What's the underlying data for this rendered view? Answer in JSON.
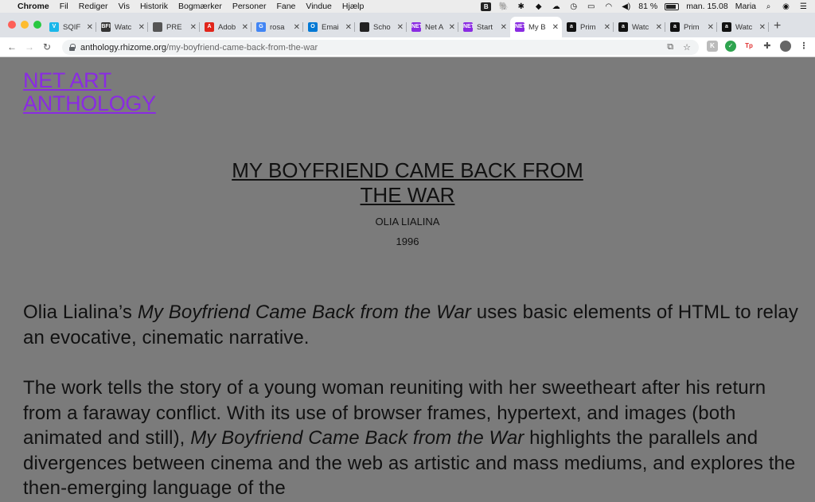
{
  "menubar": {
    "apple_icon": "apple-icon",
    "app_name": "Chrome",
    "menus": [
      "Fil",
      "Rediger",
      "Vis",
      "Historik",
      "Bogmærker",
      "Personer",
      "Fane",
      "Vindue",
      "Hjælp"
    ],
    "battery": "81 %",
    "datetime": "man. 15.08",
    "user": "Maria"
  },
  "tabs": [
    {
      "label": "SQIF",
      "favicon_color": "#1ab7ea",
      "favicon_text": "V"
    },
    {
      "label": "Watc",
      "favicon_color": "#333333",
      "favicon_text": "BFI"
    },
    {
      "label": "PRE",
      "favicon_color": "#555555",
      "favicon_text": ""
    },
    {
      "label": "Adob",
      "favicon_color": "#e1251b",
      "favicon_text": "A"
    },
    {
      "label": "rosa",
      "favicon_color": "#4285f4",
      "favicon_text": "G"
    },
    {
      "label": "Emai",
      "favicon_color": "#0078d4",
      "favicon_text": "O"
    },
    {
      "label": "Scho",
      "favicon_color": "#222222",
      "favicon_text": ""
    },
    {
      "label": "Net A",
      "favicon_color": "#8a2be2",
      "favicon_text": "NET"
    },
    {
      "label": "Start",
      "favicon_color": "#8a2be2",
      "favicon_text": "NET"
    },
    {
      "label": "My B",
      "favicon_color": "#8a2be2",
      "favicon_text": "NET"
    },
    {
      "label": "Prim",
      "favicon_color": "#111111",
      "favicon_text": "a"
    },
    {
      "label": "Watc",
      "favicon_color": "#111111",
      "favicon_text": "a"
    },
    {
      "label": "Prim",
      "favicon_color": "#111111",
      "favicon_text": "a"
    },
    {
      "label": "Watc",
      "favicon_color": "#111111",
      "favicon_text": "a"
    }
  ],
  "active_tab_index": 9,
  "toolbar": {
    "url_host": "anthology.rhizome.org",
    "url_path": "/my-boyfriend-came-back-from-the-war"
  },
  "page": {
    "logo_line1": "NET ART",
    "logo_line2": "ANTHOLOGY",
    "title_line1": "MY BOYFRIEND CAME BACK FROM",
    "title_line2": "THE WAR",
    "artist": "OLIA LIALINA",
    "year": "1996",
    "p1_a": "Olia Lialina’s ",
    "p1_em": "My Boyfriend Came Back from the War",
    "p1_b": " uses basic elements of HTML to relay an evocative, cinematic narrative.",
    "p2_a": "The work tells the story of a young woman reuniting with her sweetheart after his return from a faraway conflict. With its use of browser frames, hypertext, and images (both animated and still), ",
    "p2_em": "My Boyfriend Came Back from the War",
    "p2_b": " highlights the parallels and divergences between cinema and the web as artistic and mass mediums, and explores the then-emerging language of the"
  },
  "colors": {
    "page_bg": "#7b7b7b",
    "link_purple": "#8a2be2"
  }
}
